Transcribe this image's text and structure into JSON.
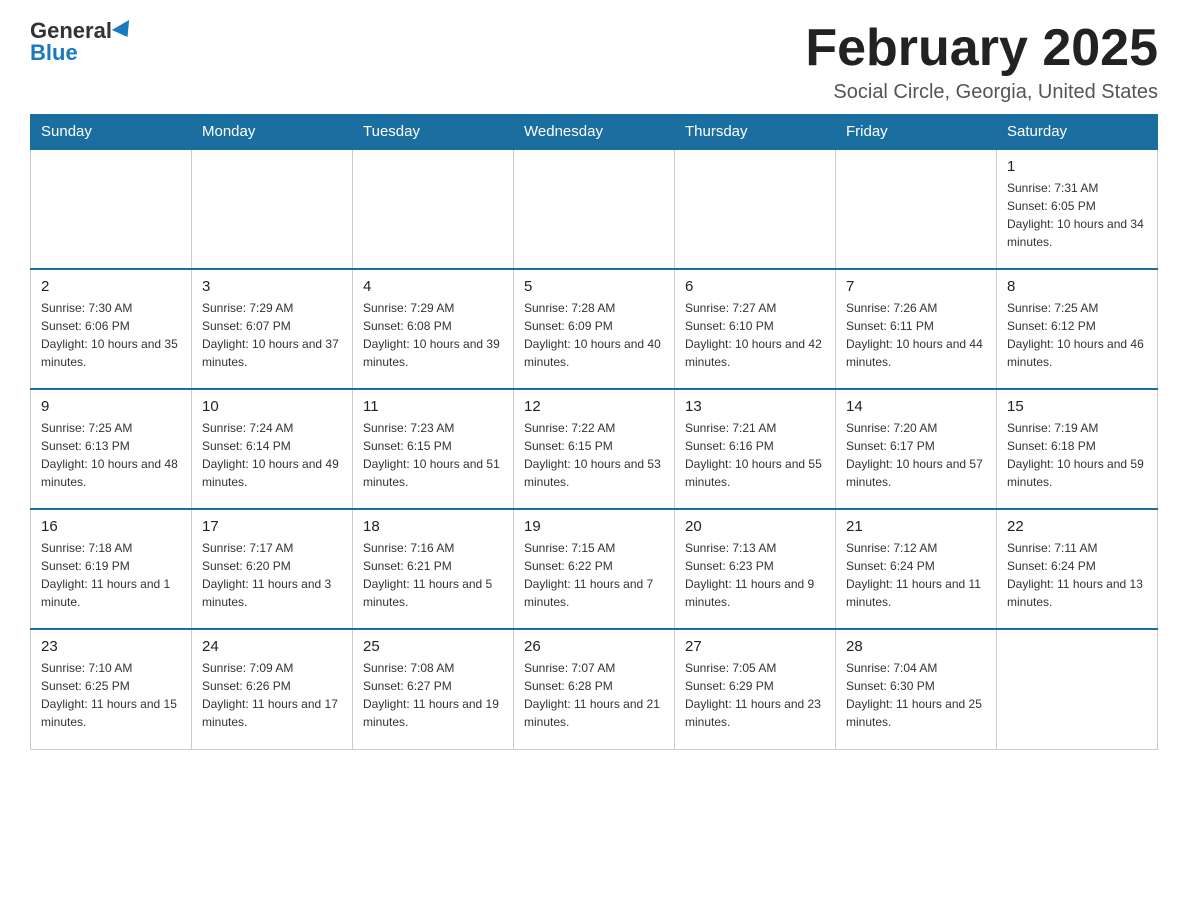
{
  "logo": {
    "text1": "General",
    "text2": "Blue"
  },
  "header": {
    "month": "February 2025",
    "location": "Social Circle, Georgia, United States"
  },
  "days_of_week": [
    "Sunday",
    "Monday",
    "Tuesday",
    "Wednesday",
    "Thursday",
    "Friday",
    "Saturday"
  ],
  "weeks": [
    [
      {
        "day": "",
        "info": ""
      },
      {
        "day": "",
        "info": ""
      },
      {
        "day": "",
        "info": ""
      },
      {
        "day": "",
        "info": ""
      },
      {
        "day": "",
        "info": ""
      },
      {
        "day": "",
        "info": ""
      },
      {
        "day": "1",
        "info": "Sunrise: 7:31 AM\nSunset: 6:05 PM\nDaylight: 10 hours and 34 minutes."
      }
    ],
    [
      {
        "day": "2",
        "info": "Sunrise: 7:30 AM\nSunset: 6:06 PM\nDaylight: 10 hours and 35 minutes."
      },
      {
        "day": "3",
        "info": "Sunrise: 7:29 AM\nSunset: 6:07 PM\nDaylight: 10 hours and 37 minutes."
      },
      {
        "day": "4",
        "info": "Sunrise: 7:29 AM\nSunset: 6:08 PM\nDaylight: 10 hours and 39 minutes."
      },
      {
        "day": "5",
        "info": "Sunrise: 7:28 AM\nSunset: 6:09 PM\nDaylight: 10 hours and 40 minutes."
      },
      {
        "day": "6",
        "info": "Sunrise: 7:27 AM\nSunset: 6:10 PM\nDaylight: 10 hours and 42 minutes."
      },
      {
        "day": "7",
        "info": "Sunrise: 7:26 AM\nSunset: 6:11 PM\nDaylight: 10 hours and 44 minutes."
      },
      {
        "day": "8",
        "info": "Sunrise: 7:25 AM\nSunset: 6:12 PM\nDaylight: 10 hours and 46 minutes."
      }
    ],
    [
      {
        "day": "9",
        "info": "Sunrise: 7:25 AM\nSunset: 6:13 PM\nDaylight: 10 hours and 48 minutes."
      },
      {
        "day": "10",
        "info": "Sunrise: 7:24 AM\nSunset: 6:14 PM\nDaylight: 10 hours and 49 minutes."
      },
      {
        "day": "11",
        "info": "Sunrise: 7:23 AM\nSunset: 6:15 PM\nDaylight: 10 hours and 51 minutes."
      },
      {
        "day": "12",
        "info": "Sunrise: 7:22 AM\nSunset: 6:15 PM\nDaylight: 10 hours and 53 minutes."
      },
      {
        "day": "13",
        "info": "Sunrise: 7:21 AM\nSunset: 6:16 PM\nDaylight: 10 hours and 55 minutes."
      },
      {
        "day": "14",
        "info": "Sunrise: 7:20 AM\nSunset: 6:17 PM\nDaylight: 10 hours and 57 minutes."
      },
      {
        "day": "15",
        "info": "Sunrise: 7:19 AM\nSunset: 6:18 PM\nDaylight: 10 hours and 59 minutes."
      }
    ],
    [
      {
        "day": "16",
        "info": "Sunrise: 7:18 AM\nSunset: 6:19 PM\nDaylight: 11 hours and 1 minute."
      },
      {
        "day": "17",
        "info": "Sunrise: 7:17 AM\nSunset: 6:20 PM\nDaylight: 11 hours and 3 minutes."
      },
      {
        "day": "18",
        "info": "Sunrise: 7:16 AM\nSunset: 6:21 PM\nDaylight: 11 hours and 5 minutes."
      },
      {
        "day": "19",
        "info": "Sunrise: 7:15 AM\nSunset: 6:22 PM\nDaylight: 11 hours and 7 minutes."
      },
      {
        "day": "20",
        "info": "Sunrise: 7:13 AM\nSunset: 6:23 PM\nDaylight: 11 hours and 9 minutes."
      },
      {
        "day": "21",
        "info": "Sunrise: 7:12 AM\nSunset: 6:24 PM\nDaylight: 11 hours and 11 minutes."
      },
      {
        "day": "22",
        "info": "Sunrise: 7:11 AM\nSunset: 6:24 PM\nDaylight: 11 hours and 13 minutes."
      }
    ],
    [
      {
        "day": "23",
        "info": "Sunrise: 7:10 AM\nSunset: 6:25 PM\nDaylight: 11 hours and 15 minutes."
      },
      {
        "day": "24",
        "info": "Sunrise: 7:09 AM\nSunset: 6:26 PM\nDaylight: 11 hours and 17 minutes."
      },
      {
        "day": "25",
        "info": "Sunrise: 7:08 AM\nSunset: 6:27 PM\nDaylight: 11 hours and 19 minutes."
      },
      {
        "day": "26",
        "info": "Sunrise: 7:07 AM\nSunset: 6:28 PM\nDaylight: 11 hours and 21 minutes."
      },
      {
        "day": "27",
        "info": "Sunrise: 7:05 AM\nSunset: 6:29 PM\nDaylight: 11 hours and 23 minutes."
      },
      {
        "day": "28",
        "info": "Sunrise: 7:04 AM\nSunset: 6:30 PM\nDaylight: 11 hours and 25 minutes."
      },
      {
        "day": "",
        "info": ""
      }
    ]
  ]
}
